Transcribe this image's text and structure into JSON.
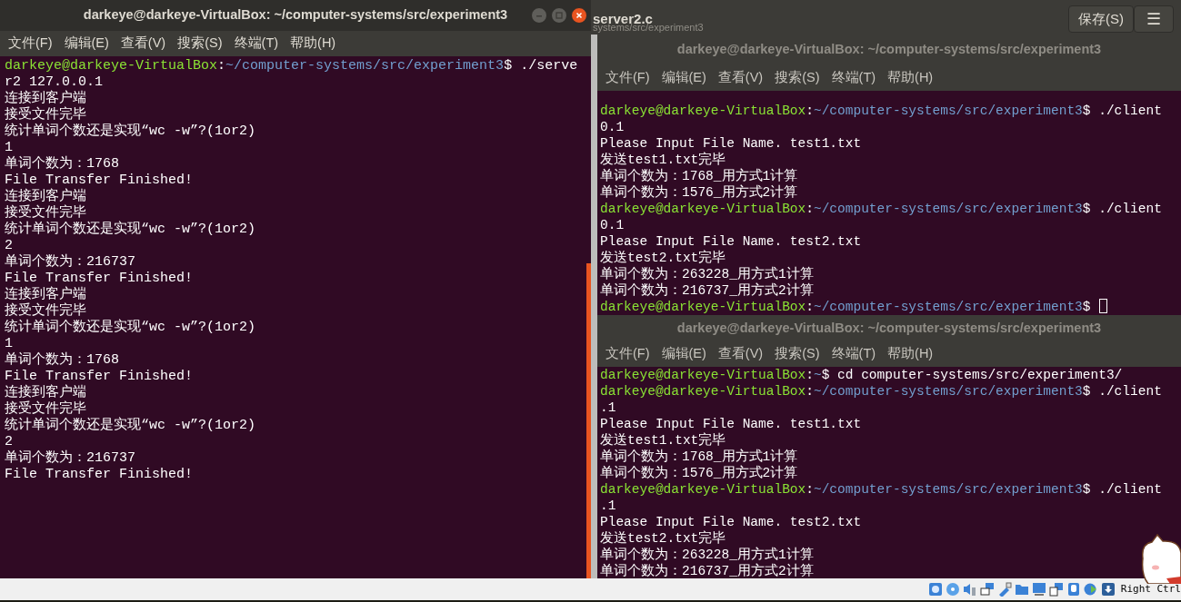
{
  "editor": {
    "title": "server2.c",
    "subtitle": "systems/src/experiment3",
    "buttons": [
      {
        "kind": "text",
        "label": "保存(S)"
      },
      {
        "kind": "menu",
        "label": "☰"
      }
    ]
  },
  "windows": [
    {
      "title": "darkeye@darkeye-VirtualBox: ~/computer-systems/src/experiment3",
      "active": true,
      "scrollbar": true,
      "menu": [
        "文件(F)",
        "编辑(E)",
        "查看(V)",
        "搜索(S)",
        "终端(T)",
        "帮助(H)"
      ],
      "lines": [
        {
          "kind": "prompt",
          "user": "darkeye@darkeye-VirtualBox",
          "colon": ":",
          "path": "~/computer-systems/src/experiment3",
          "command": "$ ./serve"
        },
        {
          "kind": "output",
          "text": "r2 127.0.0.1"
        },
        {
          "kind": "output",
          "text": "连接到客户端"
        },
        {
          "kind": "output",
          "text": "接受文件完毕"
        },
        {
          "kind": "output",
          "text": "统计单词个数还是实现“wc -w”?(1or2)"
        },
        {
          "kind": "output",
          "text": "1"
        },
        {
          "kind": "output",
          "text": "单词个数为：1768"
        },
        {
          "kind": "output",
          "text": "File Transfer Finished!"
        },
        {
          "kind": "output",
          "text": "连接到客户端"
        },
        {
          "kind": "output",
          "text": "接受文件完毕"
        },
        {
          "kind": "output",
          "text": "统计单词个数还是实现“wc -w”?(1or2)"
        },
        {
          "kind": "output",
          "text": "2"
        },
        {
          "kind": "output",
          "text": "单词个数为：216737"
        },
        {
          "kind": "output",
          "text": "File Transfer Finished!"
        },
        {
          "kind": "output",
          "text": "连接到客户端"
        },
        {
          "kind": "output",
          "text": "接受文件完毕"
        },
        {
          "kind": "output",
          "text": "统计单词个数还是实现“wc -w”?(1or2)"
        },
        {
          "kind": "output",
          "text": "1"
        },
        {
          "kind": "output",
          "text": "单词个数为：1768"
        },
        {
          "kind": "output",
          "text": "File Transfer Finished!"
        },
        {
          "kind": "output",
          "text": "连接到客户端"
        },
        {
          "kind": "output",
          "text": "接受文件完毕"
        },
        {
          "kind": "output",
          "text": "统计单词个数还是实现“wc -w”?(1or2)"
        },
        {
          "kind": "output",
          "text": "2"
        },
        {
          "kind": "output",
          "text": "单词个数为：216737"
        },
        {
          "kind": "output",
          "text": "File Transfer Finished!"
        }
      ]
    },
    {
      "title": "darkeye@darkeye-VirtualBox: ~/computer-systems/src/experiment3",
      "active": false,
      "scrollbar": false,
      "menu": [
        "文件(F)",
        "编辑(E)",
        "查看(V)",
        "搜索(S)",
        "终端(T)",
        "帮助(H)"
      ],
      "lines": [
        {
          "kind": "prompt",
          "user": "darkeye@darkeye-VirtualBox",
          "colon": ":",
          "path": "~/computer-systems/src/experiment3",
          "command": "$ ./client"
        },
        {
          "kind": "output",
          "text": "0.1"
        },
        {
          "kind": "output",
          "text": "Please Input File Name. test1.txt"
        },
        {
          "kind": "output",
          "text": "发送test1.txt完毕"
        },
        {
          "kind": "output",
          "text": "单词个数为：1768_用方式1计算"
        },
        {
          "kind": "output",
          "text": "单词个数为：1576_用方式2计算"
        },
        {
          "kind": "prompt",
          "user": "darkeye@darkeye-VirtualBox",
          "colon": ":",
          "path": "~/computer-systems/src/experiment3",
          "command": "$ ./client"
        },
        {
          "kind": "output",
          "text": "0.1"
        },
        {
          "kind": "output",
          "text": "Please Input File Name. test2.txt"
        },
        {
          "kind": "output",
          "text": "发送test2.txt完毕"
        },
        {
          "kind": "output",
          "text": "单词个数为：263228_用方式1计算"
        },
        {
          "kind": "output",
          "text": "单词个数为：216737_用方式2计算"
        },
        {
          "kind": "prompt",
          "user": "darkeye@darkeye-VirtualBox",
          "colon": ":",
          "path": "~/computer-systems/src/experiment3",
          "command": "$",
          "cursor": true
        }
      ]
    },
    {
      "title": "darkeye@darkeye-VirtualBox: ~/computer-systems/src/experiment3",
      "active": false,
      "scrollbar": false,
      "menu": [
        "文件(F)",
        "编辑(E)",
        "查看(V)",
        "搜索(S)",
        "终端(T)",
        "帮助(H)"
      ],
      "lines": [
        {
          "kind": "prompt",
          "user": "darkeye@darkeye-VirtualBox",
          "colon": ":",
          "path": "~",
          "command": "$ cd computer-systems/src/experiment3/"
        },
        {
          "kind": "prompt",
          "user": "darkeye@darkeye-VirtualBox",
          "colon": ":",
          "path": "~/computer-systems/src/experiment3",
          "command": "$ ./client"
        },
        {
          "kind": "output",
          "text": ".1"
        },
        {
          "kind": "output",
          "text": "Please Input File Name. test1.txt"
        },
        {
          "kind": "output",
          "text": "发送test1.txt完毕"
        },
        {
          "kind": "output",
          "text": "单词个数为：1768_用方式1计算"
        },
        {
          "kind": "output",
          "text": "单词个数为：1576_用方式2计算"
        },
        {
          "kind": "prompt",
          "user": "darkeye@darkeye-VirtualBox",
          "colon": ":",
          "path": "~/computer-systems/src/experiment3",
          "command": "$ ./client"
        },
        {
          "kind": "output",
          "text": ".1"
        },
        {
          "kind": "output",
          "text": "Please Input File Name. test2.txt"
        },
        {
          "kind": "output",
          "text": "发送test2.txt完毕"
        },
        {
          "kind": "output",
          "text": "单词个数为：263228_用方式1计算"
        },
        {
          "kind": "output",
          "text": "单词个数为：216737_用方式2计算"
        }
      ]
    }
  ],
  "status_bar": {
    "hint": "Right Ctrl"
  }
}
